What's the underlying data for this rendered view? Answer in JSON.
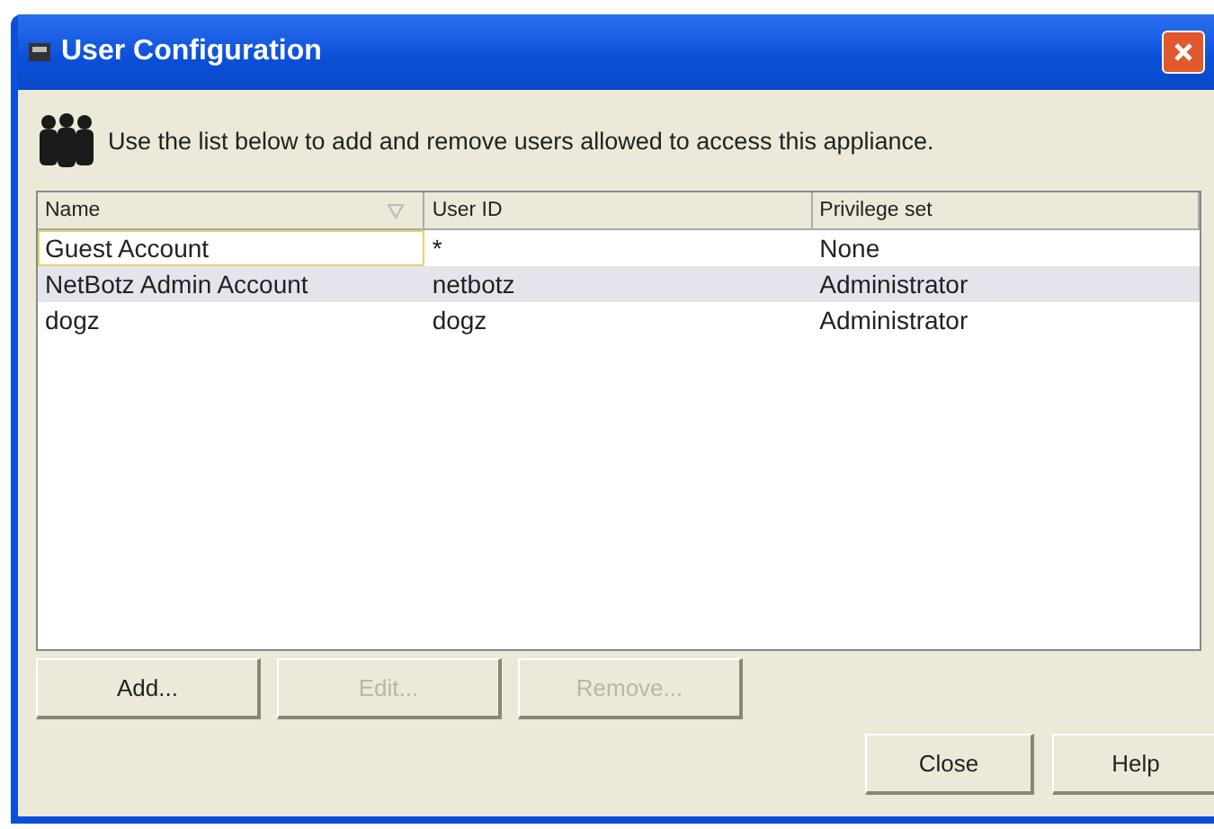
{
  "window": {
    "title": "User Configuration"
  },
  "intro": "Use the list below to add and remove users allowed to access this appliance.",
  "table": {
    "columns": [
      "Name",
      "User ID",
      "Privilege set"
    ],
    "rows": [
      {
        "cells": [
          "Guest Account",
          "*",
          "None"
        ],
        "selected": false,
        "focused": true
      },
      {
        "cells": [
          "NetBotz Admin Account",
          "netbotz",
          "Administrator"
        ],
        "selected": true,
        "focused": false
      },
      {
        "cells": [
          "dogz",
          "dogz",
          "Administrator"
        ],
        "selected": false,
        "focused": false
      }
    ]
  },
  "list_buttons": [
    {
      "label": "Add...",
      "disabled": false
    },
    {
      "label": "Edit...",
      "disabled": true
    },
    {
      "label": "Remove...",
      "disabled": true
    }
  ],
  "dialog_buttons": [
    {
      "label": "Close",
      "disabled": false
    },
    {
      "label": "Help",
      "disabled": false
    }
  ]
}
